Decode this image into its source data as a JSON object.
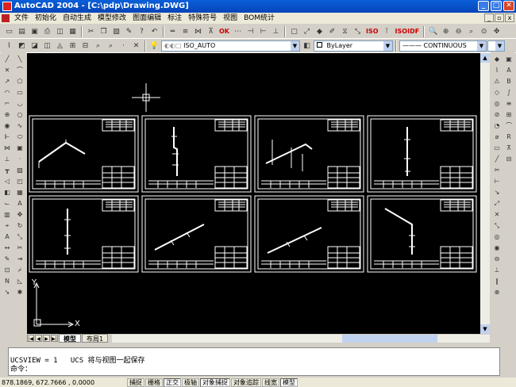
{
  "window": {
    "title": "AutoCAD 2004 - [C:\\pdp\\Drawing.DWG]"
  },
  "menu": [
    "文件",
    "初始化",
    "自动生成",
    "模型修改",
    "图面编辑",
    "标注",
    "特殊符号",
    "视图",
    "BOM统计"
  ],
  "toolbar1": {
    "texts": [
      "ISO",
      "IDF",
      "OK",
      "ISO",
      "IDF"
    ]
  },
  "toolbar2": {
    "layer_combo": "ISO_AUTO",
    "color_combo": "ByLayer",
    "linetype_combo": "CONTINUOUS"
  },
  "ucs": {
    "x_label": "X",
    "y_label": "Y"
  },
  "tabs": [
    "模型",
    "布局1"
  ],
  "command": {
    "line1": "",
    "line2": "UCSVIEW = 1   UCS 将与视图一起保存",
    "line3": "命令："
  },
  "status": {
    "coords": "878.1869,  672.7666 , 0.0000",
    "buttons": [
      "捕捉",
      "栅格",
      "正交",
      "极轴",
      "对象捕捉",
      "对象追踪",
      "线宽",
      "模型"
    ]
  }
}
